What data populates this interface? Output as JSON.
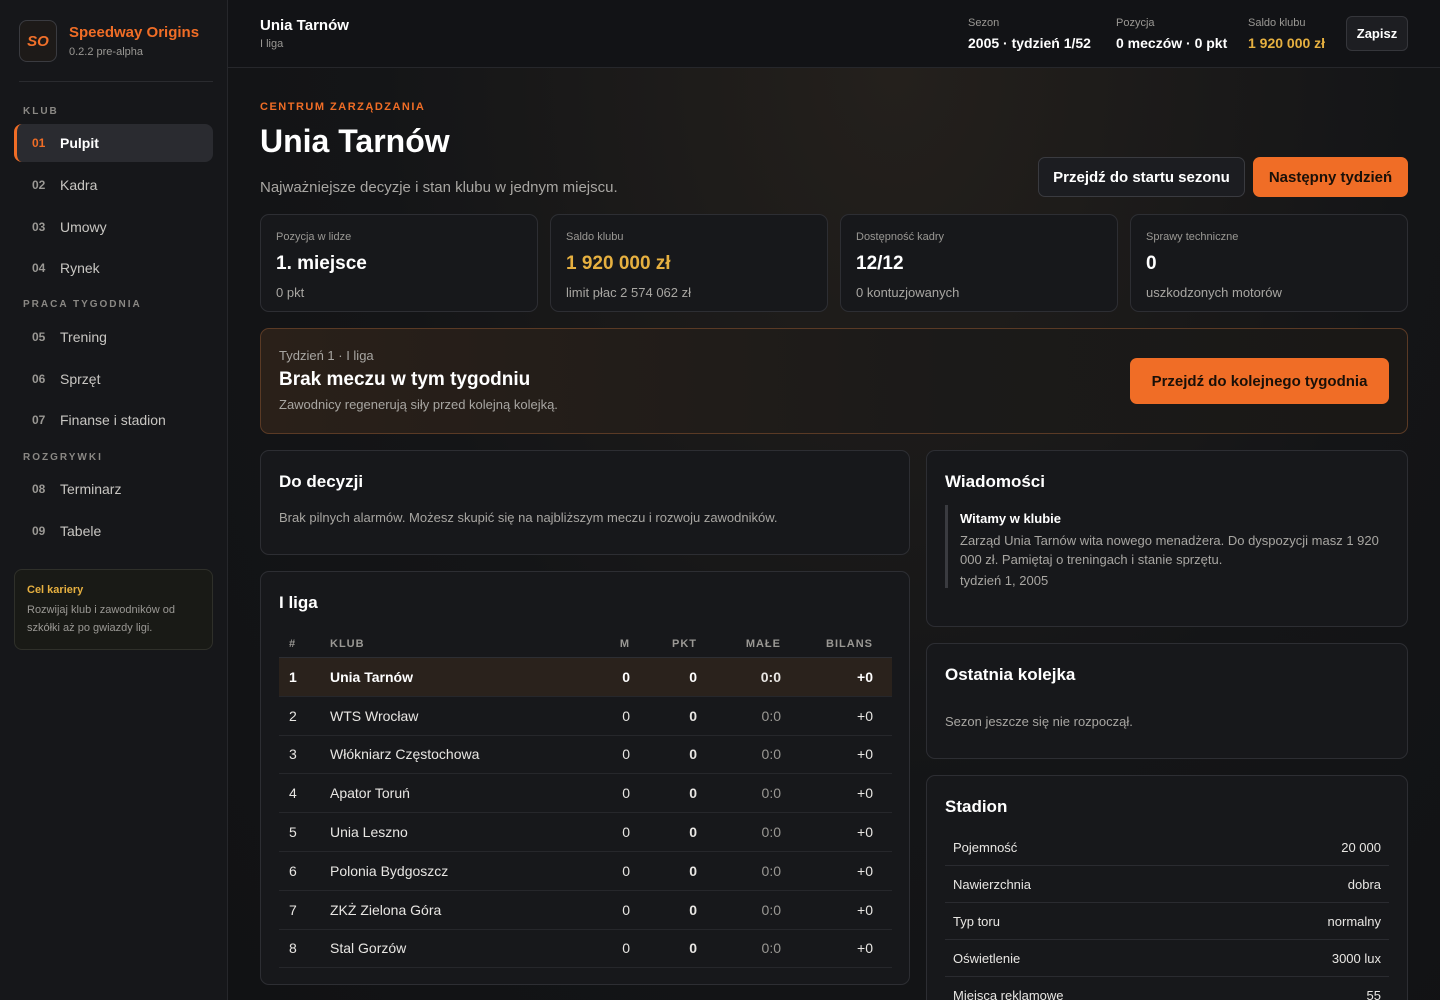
{
  "brand": {
    "logo": "SO",
    "name": "Speedway Origins",
    "version": "0.2.2 pre-alpha"
  },
  "nav": {
    "sections": [
      "KLUB",
      "PRACA TYGODNIA",
      "ROZGRYWKI"
    ],
    "items": [
      {
        "num": "01",
        "label": "Pulpit"
      },
      {
        "num": "02",
        "label": "Kadra"
      },
      {
        "num": "03",
        "label": "Umowy"
      },
      {
        "num": "04",
        "label": "Rynek"
      },
      {
        "num": "05",
        "label": "Trening"
      },
      {
        "num": "06",
        "label": "Sprzęt"
      },
      {
        "num": "07",
        "label": "Finanse i stadion"
      },
      {
        "num": "08",
        "label": "Terminarz"
      },
      {
        "num": "09",
        "label": "Tabele"
      }
    ],
    "active_index": 0
  },
  "career": {
    "title": "Cel kariery",
    "text": "Rozwijaj klub i zawodników od szkółki aż po gwiazdy ligi."
  },
  "header": {
    "club": "Unia Tarnów",
    "league": "I liga",
    "season_label": "Sezon",
    "season_value": "2005 · tydzień 1/52",
    "position_label": "Pozycja",
    "position_value": "0 meczów · 0 pkt",
    "balance_label": "Saldo klubu",
    "balance_value": "1 920 000 zł",
    "save_label": "Zapisz"
  },
  "hero": {
    "eyebrow": "CENTRUM ZARZĄDZANIA",
    "title": "Unia Tarnów",
    "subtitle": "Najważniejsze decyzje i stan klubu w jednym miejscu.",
    "btn_season_start": "Przejdź do startu sezonu",
    "btn_next_week": "Następny tydzień"
  },
  "stats": [
    {
      "label": "Pozycja w lidze",
      "value": "1. miejsce",
      "sub": "0 pkt",
      "accent": false
    },
    {
      "label": "Saldo klubu",
      "value": "1 920 000 zł",
      "sub": "limit płac 2 574 062 zł",
      "accent": true
    },
    {
      "label": "Dostępność kadry",
      "value": "12/12",
      "sub": "0 kontuzjowanych",
      "accent": false
    },
    {
      "label": "Sprawy techniczne",
      "value": "0",
      "sub": "uszkodzonych motorów",
      "accent": false
    }
  ],
  "week": {
    "pre": "Tydzień 1 · I liga",
    "title": "Brak meczu w tym tygodniu",
    "sub": "Zawodnicy regenerują siły przed kolejną kolejką.",
    "button": "Przejdź do kolejnego tygodnia"
  },
  "decisions": {
    "title": "Do decyzji",
    "text": "Brak pilnych alarmów. Możesz skupić się na najbliższym meczu i rozwoju zawodników."
  },
  "table": {
    "title": "I liga",
    "headers": {
      "pos": "#",
      "club": "KLUB",
      "m": "M",
      "pkt": "PKT",
      "male": "MAŁE",
      "bil": "BILANS"
    },
    "rows": [
      {
        "pos": "1",
        "club": "Unia Tarnów",
        "m": "0",
        "pkt": "0",
        "male": "0:0",
        "bil": "+0",
        "highlight": true
      },
      {
        "pos": "2",
        "club": "WTS Wrocław",
        "m": "0",
        "pkt": "0",
        "male": "0:0",
        "bil": "+0"
      },
      {
        "pos": "3",
        "club": "Włókniarz Częstochowa",
        "m": "0",
        "pkt": "0",
        "male": "0:0",
        "bil": "+0"
      },
      {
        "pos": "4",
        "club": "Apator Toruń",
        "m": "0",
        "pkt": "0",
        "male": "0:0",
        "bil": "+0"
      },
      {
        "pos": "5",
        "club": "Unia Leszno",
        "m": "0",
        "pkt": "0",
        "male": "0:0",
        "bil": "+0"
      },
      {
        "pos": "6",
        "club": "Polonia Bydgoszcz",
        "m": "0",
        "pkt": "0",
        "male": "0:0",
        "bil": "+0"
      },
      {
        "pos": "7",
        "club": "ZKŻ Zielona Góra",
        "m": "0",
        "pkt": "0",
        "male": "0:0",
        "bil": "+0"
      },
      {
        "pos": "8",
        "club": "Stal Gorzów",
        "m": "0",
        "pkt": "0",
        "male": "0:0",
        "bil": "+0"
      }
    ]
  },
  "news": {
    "title": "Wiadomości",
    "item_title": "Witamy w klubie",
    "item_body": "Zarząd Unia Tarnów wita nowego menadżera. Do dyspozycji masz 1 920 000 zł. Pamiętaj o treningach i stanie sprzętu.",
    "item_date": "tydzień 1, 2005"
  },
  "last_round": {
    "title": "Ostatnia kolejka",
    "text": "Sezon jeszcze się nie rozpoczął."
  },
  "stadium": {
    "title": "Stadion",
    "rows": [
      {
        "k": "Pojemność",
        "v": "20 000"
      },
      {
        "k": "Nawierzchnia",
        "v": "dobra"
      },
      {
        "k": "Typ toru",
        "v": "normalny"
      },
      {
        "k": "Oświetlenie",
        "v": "3000 lux"
      },
      {
        "k": "Miejsca reklamowe",
        "v": "55"
      }
    ]
  },
  "colors": {
    "accent": "#f06d26",
    "gold": "#e6b040",
    "background": "#0f1012"
  }
}
